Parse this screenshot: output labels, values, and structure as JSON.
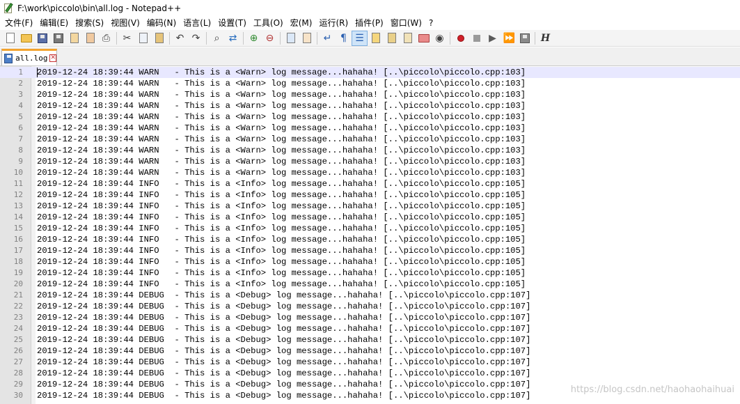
{
  "window": {
    "title": "F:\\work\\piccolo\\bin\\all.log - Notepad++"
  },
  "menu": [
    "文件(F)",
    "编辑(E)",
    "搜索(S)",
    "视图(V)",
    "编码(N)",
    "语言(L)",
    "设置(T)",
    "工具(O)",
    "宏(M)",
    "运行(R)",
    "插件(P)",
    "窗口(W)",
    "?"
  ],
  "toolbar": {
    "groups": [
      [
        "new-file-icon",
        "open-file-icon",
        "save-icon",
        "save-all-icon",
        "close-icon",
        "close-all-icon",
        "print-icon"
      ],
      [
        "cut-icon",
        "copy-icon",
        "paste-icon"
      ],
      [
        "undo-icon",
        "redo-icon"
      ],
      [
        "find-icon",
        "replace-icon"
      ],
      [
        "zoom-in-icon",
        "zoom-out-icon"
      ],
      [
        "sync-vertical-icon",
        "sync-horizontal-icon"
      ],
      [
        "word-wrap-icon",
        "show-all-chars-icon",
        "indent-guide-icon",
        "user-language-icon",
        "doc-map-icon",
        "function-list-icon",
        "folder-workspace-icon",
        "monitoring-icon"
      ],
      [
        "record-macro-icon",
        "stop-record-icon",
        "play-macro-icon",
        "run-macro-multiple-icon",
        "save-macro-icon"
      ],
      [
        "hex-editor-icon"
      ]
    ],
    "active": "indent-guide-icon"
  },
  "tabs": [
    {
      "label": "all.log"
    }
  ],
  "editor": {
    "current_line": 1,
    "lines": [
      "2019-12-24 18:39:44 WARN   - This is a <Warn> log message...hahaha! [..\\piccolo\\piccolo.cpp:103]",
      "2019-12-24 18:39:44 WARN   - This is a <Warn> log message...hahaha! [..\\piccolo\\piccolo.cpp:103]",
      "2019-12-24 18:39:44 WARN   - This is a <Warn> log message...hahaha! [..\\piccolo\\piccolo.cpp:103]",
      "2019-12-24 18:39:44 WARN   - This is a <Warn> log message...hahaha! [..\\piccolo\\piccolo.cpp:103]",
      "2019-12-24 18:39:44 WARN   - This is a <Warn> log message...hahaha! [..\\piccolo\\piccolo.cpp:103]",
      "2019-12-24 18:39:44 WARN   - This is a <Warn> log message...hahaha! [..\\piccolo\\piccolo.cpp:103]",
      "2019-12-24 18:39:44 WARN   - This is a <Warn> log message...hahaha! [..\\piccolo\\piccolo.cpp:103]",
      "2019-12-24 18:39:44 WARN   - This is a <Warn> log message...hahaha! [..\\piccolo\\piccolo.cpp:103]",
      "2019-12-24 18:39:44 WARN   - This is a <Warn> log message...hahaha! [..\\piccolo\\piccolo.cpp:103]",
      "2019-12-24 18:39:44 WARN   - This is a <Warn> log message...hahaha! [..\\piccolo\\piccolo.cpp:103]",
      "2019-12-24 18:39:44 INFO   - This is a <Info> log message...hahaha! [..\\piccolo\\piccolo.cpp:105]",
      "2019-12-24 18:39:44 INFO   - This is a <Info> log message...hahaha! [..\\piccolo\\piccolo.cpp:105]",
      "2019-12-24 18:39:44 INFO   - This is a <Info> log message...hahaha! [..\\piccolo\\piccolo.cpp:105]",
      "2019-12-24 18:39:44 INFO   - This is a <Info> log message...hahaha! [..\\piccolo\\piccolo.cpp:105]",
      "2019-12-24 18:39:44 INFO   - This is a <Info> log message...hahaha! [..\\piccolo\\piccolo.cpp:105]",
      "2019-12-24 18:39:44 INFO   - This is a <Info> log message...hahaha! [..\\piccolo\\piccolo.cpp:105]",
      "2019-12-24 18:39:44 INFO   - This is a <Info> log message...hahaha! [..\\piccolo\\piccolo.cpp:105]",
      "2019-12-24 18:39:44 INFO   - This is a <Info> log message...hahaha! [..\\piccolo\\piccolo.cpp:105]",
      "2019-12-24 18:39:44 INFO   - This is a <Info> log message...hahaha! [..\\piccolo\\piccolo.cpp:105]",
      "2019-12-24 18:39:44 INFO   - This is a <Info> log message...hahaha! [..\\piccolo\\piccolo.cpp:105]",
      "2019-12-24 18:39:44 DEBUG  - This is a <Debug> log message...hahaha! [..\\piccolo\\piccolo.cpp:107]",
      "2019-12-24 18:39:44 DEBUG  - This is a <Debug> log message...hahaha! [..\\piccolo\\piccolo.cpp:107]",
      "2019-12-24 18:39:44 DEBUG  - This is a <Debug> log message...hahaha! [..\\piccolo\\piccolo.cpp:107]",
      "2019-12-24 18:39:44 DEBUG  - This is a <Debug> log message...hahaha! [..\\piccolo\\piccolo.cpp:107]",
      "2019-12-24 18:39:44 DEBUG  - This is a <Debug> log message...hahaha! [..\\piccolo\\piccolo.cpp:107]",
      "2019-12-24 18:39:44 DEBUG  - This is a <Debug> log message...hahaha! [..\\piccolo\\piccolo.cpp:107]",
      "2019-12-24 18:39:44 DEBUG  - This is a <Debug> log message...hahaha! [..\\piccolo\\piccolo.cpp:107]",
      "2019-12-24 18:39:44 DEBUG  - This is a <Debug> log message...hahaha! [..\\piccolo\\piccolo.cpp:107]",
      "2019-12-24 18:39:44 DEBUG  - This is a <Debug> log message...hahaha! [..\\piccolo\\piccolo.cpp:107]",
      "2019-12-24 18:39:44 DEBUG  - This is a <Debug> log message...hahaha! [..\\piccolo\\piccolo.cpp:107]"
    ]
  },
  "watermark": "https://blog.csdn.net/haohaohaihuai",
  "colors": {
    "gutter_bg": "#e4e4e4",
    "line_number": "#808080",
    "current_line_bg": "#e8e8ff",
    "tab_accent": "#f3a32e",
    "toolbar_active_bg": "#cfe4f8"
  }
}
